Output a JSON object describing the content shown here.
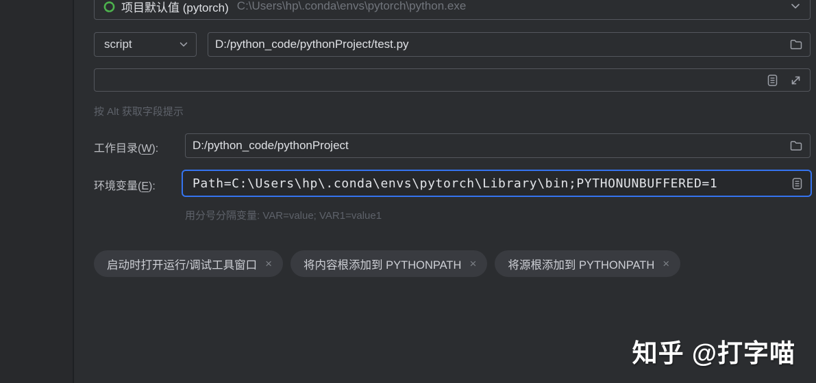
{
  "app": {
    "background": "#2b2d30",
    "focus_color": "#3574f0",
    "accent_green": "#4db34d"
  },
  "interpreter_row": {
    "icon": "conda-environment-icon",
    "name": "项目默认值 (pytorch)",
    "path": "C:\\Users\\hp\\.conda\\envs\\pytorch\\python.exe"
  },
  "script_row": {
    "target_type": "script",
    "path": "D:/python_code/pythonProject/test.py"
  },
  "parameters_row": {
    "value": ""
  },
  "alt_hint": "按 Alt 获取字段提示",
  "working_dir_row": {
    "label_prefix": "工作目录(",
    "mnemonic": "W",
    "label_suffix": "):",
    "value": "D:/python_code/pythonProject"
  },
  "env_row": {
    "label_prefix": "环境变量(",
    "mnemonic": "E",
    "label_suffix": "):",
    "value": "Path=C:\\Users\\hp\\.conda\\envs\\pytorch\\Library\\bin;PYTHONUNBUFFERED=1"
  },
  "env_hint": "用分号分隔变量: VAR=value; VAR1=value1",
  "option_tags": [
    {
      "label": "启动时打开运行/调试工具窗口",
      "close": "×"
    },
    {
      "label": "将内容根添加到 PYTHONPATH",
      "close": "×"
    },
    {
      "label": "将源根添加到 PYTHONPATH",
      "close": "×"
    }
  ],
  "watermark": "知乎 @打字喵"
}
